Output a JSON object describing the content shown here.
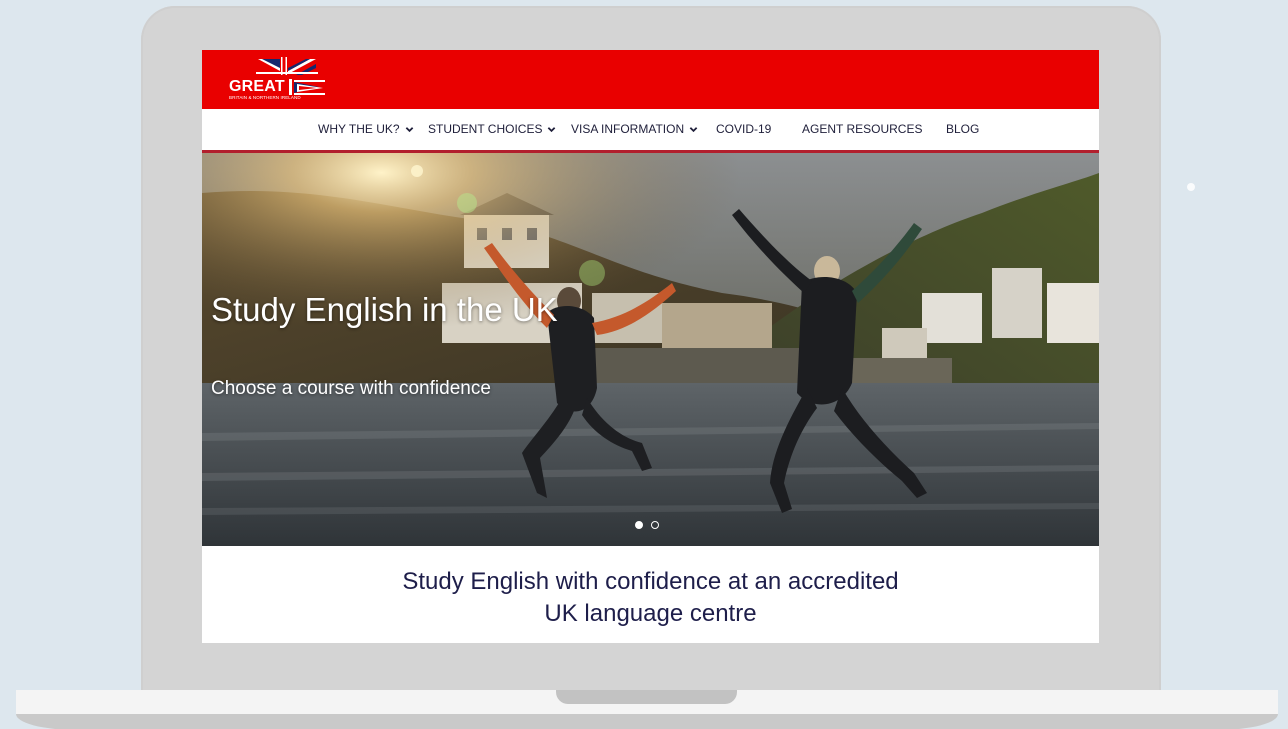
{
  "site": {
    "logo": {
      "word": "GREAT",
      "subtitle": "BRITAIN & NORTHERN IRELAND"
    },
    "colors": {
      "brand_red": "#e90000",
      "nav_underline": "#b21f2d",
      "text_navy": "#1e1e4a"
    }
  },
  "nav": {
    "items": [
      {
        "label": "WHY THE UK?",
        "dropdown": true
      },
      {
        "label": "STUDENT CHOICES",
        "dropdown": true
      },
      {
        "label": "VISA INFORMATION",
        "dropdown": true
      },
      {
        "label": "COVID-19",
        "dropdown": false
      },
      {
        "label": "AGENT RESOURCES",
        "dropdown": false
      },
      {
        "label": "BLOG",
        "dropdown": false
      }
    ]
  },
  "hero": {
    "title": "Study English in the UK",
    "subtitle": "Choose a course with confidence",
    "slides_total": 2,
    "active_slide": 1
  },
  "main": {
    "headline_line1": "Study English with confidence at an accredited",
    "headline_line2": "UK language centre"
  }
}
